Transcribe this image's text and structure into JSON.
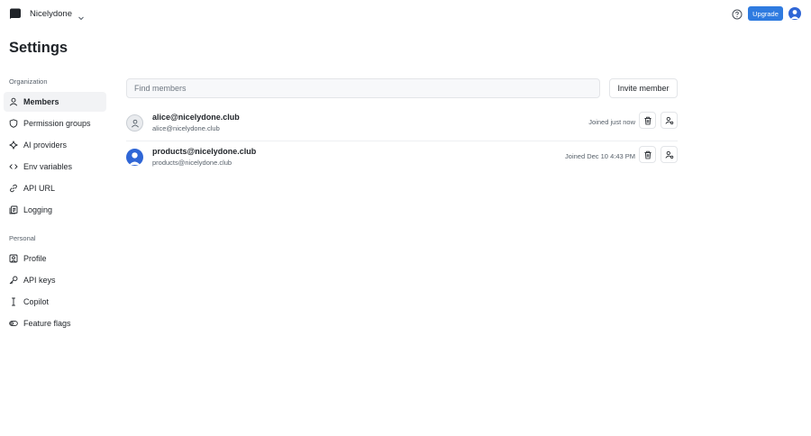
{
  "header": {
    "org_name": "Nicelydone",
    "upgrade_label": "Upgrade",
    "logo_icon": "chat-bubble-logo-icon",
    "help_icon": "help-circle-icon",
    "colors": {
      "accent": "#2f7be0",
      "avatar": "#2f66d6"
    }
  },
  "page": {
    "title": "Settings"
  },
  "sidebar": {
    "organization_label": "Organization",
    "organization_items": [
      {
        "label": "Members",
        "icon": "user-icon",
        "active": true
      },
      {
        "label": "Permission groups",
        "icon": "shield-icon"
      },
      {
        "label": "AI providers",
        "icon": "sparkle-icon"
      },
      {
        "label": "Env variables",
        "icon": "code-icon"
      },
      {
        "label": "API URL",
        "icon": "link-icon"
      },
      {
        "label": "Logging",
        "icon": "log-icon"
      }
    ],
    "personal_label": "Personal",
    "personal_items": [
      {
        "label": "Profile",
        "icon": "profile-icon"
      },
      {
        "label": "API keys",
        "icon": "key-icon"
      },
      {
        "label": "Copilot",
        "icon": "text-cursor-icon"
      },
      {
        "label": "Feature flags",
        "icon": "toggle-icon"
      }
    ]
  },
  "members": {
    "search_placeholder": "Find members",
    "invite_label": "Invite member",
    "list": [
      {
        "name": "alice@nicelydone.club",
        "email": "alice@nicelydone.club",
        "joined": "Joined just now",
        "avatar": "default-user-icon"
      },
      {
        "name": "products@nicelydone.club",
        "email": "products@nicelydone.club",
        "joined": "Joined Dec 10 4:43 PM",
        "avatar": "blue-user-avatar"
      }
    ],
    "delete_icon": "trash-icon",
    "role_icon": "user-settings-icon"
  }
}
